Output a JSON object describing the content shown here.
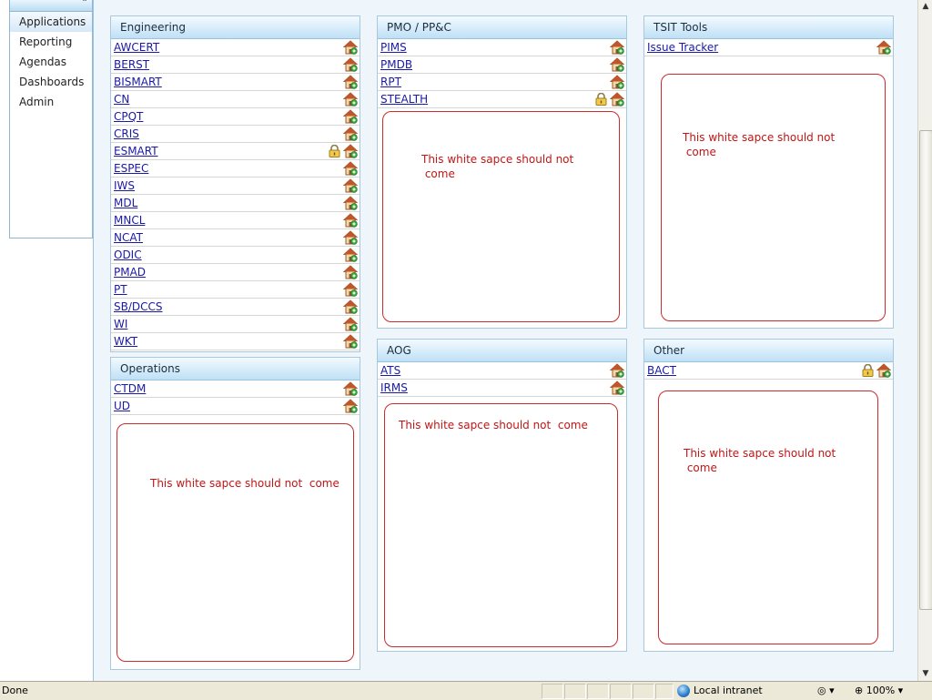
{
  "nav": {
    "items": [
      {
        "label": "Applications",
        "selected": true
      },
      {
        "label": "Reporting",
        "selected": false
      },
      {
        "label": "Agendas",
        "selected": false
      },
      {
        "label": "Dashboards",
        "selected": false
      },
      {
        "label": "Admin",
        "selected": false
      }
    ],
    "collapse_icon": "chevron-up-icon"
  },
  "panels": {
    "engineering": {
      "title": "Engineering",
      "items": [
        {
          "label": "AWCERT",
          "locked": false
        },
        {
          "label": "BERST",
          "locked": false
        },
        {
          "label": "BISMART",
          "locked": false
        },
        {
          "label": "CN",
          "locked": false
        },
        {
          "label": "CPQT",
          "locked": false
        },
        {
          "label": "CRIS",
          "locked": false
        },
        {
          "label": "ESMART",
          "locked": true
        },
        {
          "label": "ESPEC",
          "locked": false
        },
        {
          "label": "IWS",
          "locked": false
        },
        {
          "label": "MDL",
          "locked": false
        },
        {
          "label": "MNCL",
          "locked": false
        },
        {
          "label": "NCAT",
          "locked": false
        },
        {
          "label": "ODIC",
          "locked": false
        },
        {
          "label": "PMAD",
          "locked": false
        },
        {
          "label": "PT",
          "locked": false
        },
        {
          "label": "SB/DCCS",
          "locked": false
        },
        {
          "label": "WI",
          "locked": false
        },
        {
          "label": "WKT",
          "locked": false
        }
      ]
    },
    "operations": {
      "title": "Operations",
      "items": [
        {
          "label": "CTDM",
          "locked": false
        },
        {
          "label": "UD",
          "locked": false
        }
      ],
      "note": "This white sapce should not  come"
    },
    "pmo": {
      "title": "PMO / PP&C",
      "items": [
        {
          "label": "PIMS",
          "locked": false
        },
        {
          "label": "PMDB",
          "locked": false
        },
        {
          "label": "RPT",
          "locked": false
        },
        {
          "label": "STEALTH",
          "locked": true
        }
      ],
      "note": "This white sapce should not\n come"
    },
    "aog": {
      "title": "AOG",
      "items": [
        {
          "label": "ATS",
          "locked": false
        },
        {
          "label": "IRMS",
          "locked": false
        }
      ],
      "note": "This white sapce should not  come"
    },
    "tsit": {
      "title": "TSIT Tools",
      "items": [
        {
          "label": "Issue Tracker",
          "locked": false
        }
      ],
      "note": "This white sapce should not\n come"
    },
    "other": {
      "title": "Other",
      "items": [
        {
          "label": "BACT",
          "locked": true
        }
      ],
      "note": "This white sapce should not\n come"
    }
  },
  "colors": {
    "link": "#1a1aa6",
    "note_text": "#c01616",
    "note_border": "#cc2b2b",
    "header_gradient_bottom": "#bfe0f5"
  },
  "statusbar": {
    "status": "Done",
    "zone": "Local intranet",
    "zoom": "100%"
  }
}
